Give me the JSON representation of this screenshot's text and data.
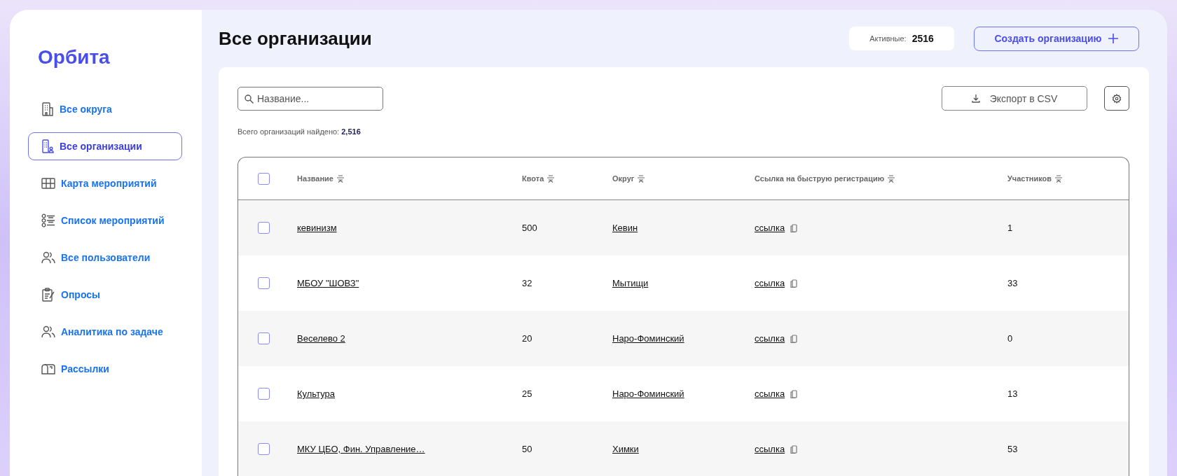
{
  "sidebar": {
    "logo": "Орбита",
    "items": [
      {
        "label": "Все округа",
        "selected": false
      },
      {
        "label": "Все организации",
        "selected": true
      },
      {
        "label": "Карта мероприятий",
        "selected": false
      },
      {
        "label": "Список мероприятий",
        "selected": false
      },
      {
        "label": "Все пользователи",
        "selected": false
      },
      {
        "label": "Опросы",
        "selected": false
      },
      {
        "label": "Аналитика по задаче",
        "selected": false
      },
      {
        "label": "Рассылки",
        "selected": false
      }
    ]
  },
  "header": {
    "title": "Все организации",
    "active_label": "Активные:",
    "active_count": "2516",
    "create_button": "Создать организацию"
  },
  "search": {
    "placeholder": "Название..."
  },
  "export_button": "Экспорт в CSV",
  "total": {
    "label": "Всего организаций найдено:",
    "count": "2,516"
  },
  "table": {
    "select_all": {
      "checked": false
    },
    "columns": [
      "Название",
      "Квота",
      "Округ",
      "Ссылка на быструю регистрацию",
      "Участников"
    ],
    "rows": [
      {
        "checked": false,
        "name": "кевинизм",
        "quota": "500",
        "district": "Кевин",
        "link": "ссылка",
        "participants": "1"
      },
      {
        "checked": false,
        "name": "МБОУ \"ШОВЗ\"",
        "quota": "32",
        "district": "Мытищи",
        "link": "ссылка",
        "participants": "33"
      },
      {
        "checked": false,
        "name": "Веселево 2",
        "quota": "20",
        "district": "Наро-Фоминский",
        "link": "ссылка",
        "participants": "0"
      },
      {
        "checked": false,
        "name": "Культура",
        "quota": "25",
        "district": "Наро-Фоминский",
        "link": "ссылка",
        "participants": "13"
      },
      {
        "checked": false,
        "name": "МКУ ЦБО, Фин. Управление…",
        "quota": "50",
        "district": "Химки",
        "link": "ссылка",
        "participants": "53"
      }
    ]
  }
}
